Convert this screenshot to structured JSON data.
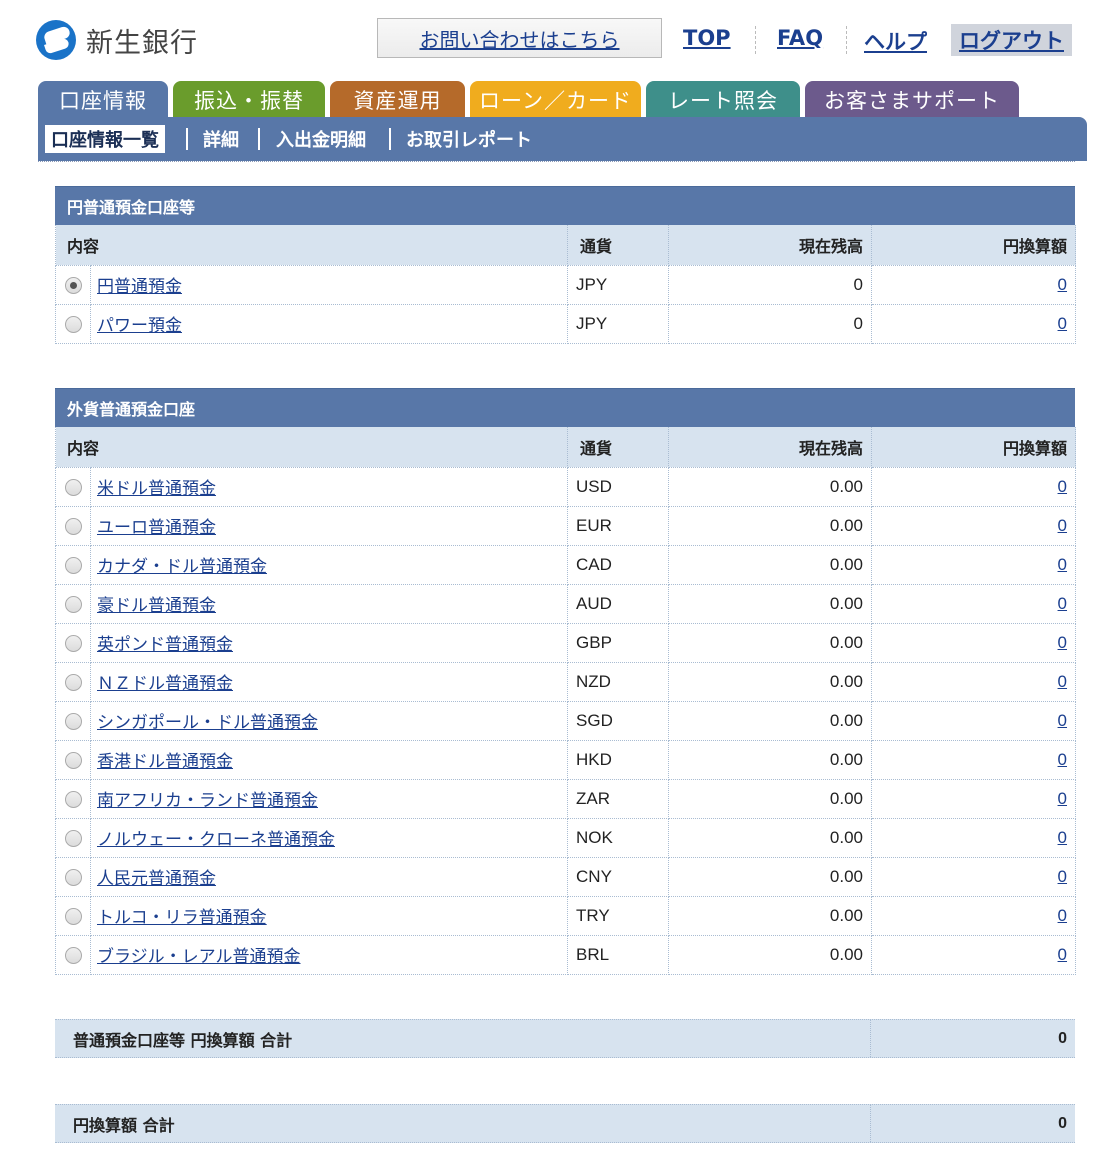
{
  "header": {
    "bank_name": "新生銀行",
    "contact_label": "お問い合わせはこちら",
    "links": [
      "TOP",
      "FAQ",
      "ヘルプ"
    ],
    "logout_label": "ログアウト"
  },
  "tabs": [
    {
      "label": "口座情報",
      "color": "#5877a8",
      "active": true
    },
    {
      "label": "振込・振替",
      "color": "#6a9c2c",
      "active": false
    },
    {
      "label": "資産運用",
      "color": "#b56a2a",
      "active": false
    },
    {
      "label": "ローン／カード",
      "color": "#f0ac1e",
      "active": false
    },
    {
      "label": "レート照会",
      "color": "#3e8f8a",
      "active": false
    },
    {
      "label": "お客さまサポート",
      "color": "#6c5a8c",
      "active": false
    }
  ],
  "subnav": [
    "口座情報一覧",
    "詳細",
    "入出金明細",
    "お取引レポート"
  ],
  "columns": {
    "name": "内容",
    "currency": "通貨",
    "balance": "現在残高",
    "yen": "円換算額"
  },
  "yen_section": {
    "title": "円普通預金口座等",
    "rows": [
      {
        "name": "円普通預金",
        "currency": "JPY",
        "balance": "0",
        "yen": "0",
        "selected": true
      },
      {
        "name": "パワー預金",
        "currency": "JPY",
        "balance": "0",
        "yen": "0",
        "selected": false
      }
    ]
  },
  "fx_section": {
    "title": "外貨普通預金口座",
    "rows": [
      {
        "name": "米ドル普通預金",
        "currency": "USD",
        "balance": "0.00",
        "yen": "0"
      },
      {
        "name": "ユーロ普通預金",
        "currency": "EUR",
        "balance": "0.00",
        "yen": "0"
      },
      {
        "name": "カナダ・ドル普通預金",
        "currency": "CAD",
        "balance": "0.00",
        "yen": "0"
      },
      {
        "name": "豪ドル普通預金",
        "currency": "AUD",
        "balance": "0.00",
        "yen": "0"
      },
      {
        "name": "英ポンド普通預金",
        "currency": "GBP",
        "balance": "0.00",
        "yen": "0"
      },
      {
        "name": "ＮＺドル普通預金",
        "currency": "NZD",
        "balance": "0.00",
        "yen": "0"
      },
      {
        "name": "シンガポール・ドル普通預金",
        "currency": "SGD",
        "balance": "0.00",
        "yen": "0"
      },
      {
        "name": "香港ドル普通預金",
        "currency": "HKD",
        "balance": "0.00",
        "yen": "0"
      },
      {
        "name": "南アフリカ・ランド普通預金",
        "currency": "ZAR",
        "balance": "0.00",
        "yen": "0"
      },
      {
        "name": "ノルウェー・クローネ普通預金",
        "currency": "NOK",
        "balance": "0.00",
        "yen": "0"
      },
      {
        "name": "人民元普通預金",
        "currency": "CNY",
        "balance": "0.00",
        "yen": "0"
      },
      {
        "name": "トルコ・リラ普通預金",
        "currency": "TRY",
        "balance": "0.00",
        "yen": "0"
      },
      {
        "name": "ブラジル・レアル普通預金",
        "currency": "BRL",
        "balance": "0.00",
        "yen": "0"
      }
    ]
  },
  "totals": [
    {
      "label": "普通預金口座等 円換算額 合計",
      "value": "0"
    },
    {
      "label": "円換算額 合計",
      "value": "0"
    }
  ]
}
